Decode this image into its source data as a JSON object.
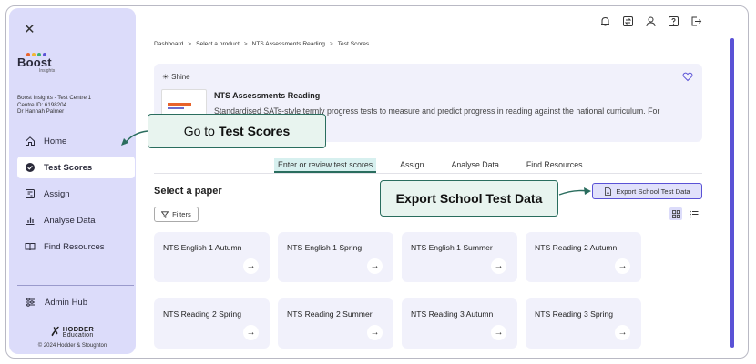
{
  "sidebar": {
    "close_glyph": "✕",
    "logo_word": "Boost",
    "logo_sub": "Insights",
    "centre_line1": "Boost Insights - Test Centre 1",
    "centre_line2": "Centre ID: 6198204",
    "centre_line3": "Dr Hannah Palmer",
    "items": [
      {
        "label": "Home",
        "icon": "home-icon"
      },
      {
        "label": "Test Scores",
        "icon": "check-circle-icon",
        "active": true
      },
      {
        "label": "Assign",
        "icon": "assign-icon"
      },
      {
        "label": "Analyse Data",
        "icon": "bar-chart-icon"
      },
      {
        "label": "Find Resources",
        "icon": "book-icon"
      }
    ],
    "admin_hub": "Admin Hub",
    "publisher_word": "HODDER",
    "publisher_sub": "Education",
    "copyright": "© 2024 Hodder & Stoughton"
  },
  "header": {
    "icons": [
      "bell-icon",
      "switch-icon",
      "user-icon",
      "help-icon",
      "logout-icon"
    ]
  },
  "breadcrumb": {
    "items": [
      "Dashboard",
      "Select a product",
      "NTS Assessments Reading",
      "Test Scores"
    ],
    "separator": ">"
  },
  "product": {
    "brand": "Shine",
    "title": "NTS Assessments Reading",
    "description": "Standardised SATs-style termly progress tests to measure and predict progress in reading against the national curriculum. For"
  },
  "callouts": {
    "first_prefix": "Go to",
    "first_bold": "Test Scores",
    "second": "Export School Test Data"
  },
  "tabs": [
    {
      "label": "Enter or review test scores",
      "active": true
    },
    {
      "label": "Assign"
    },
    {
      "label": "Analyse Data"
    },
    {
      "label": "Find Resources"
    }
  ],
  "main": {
    "select_paper": "Select a paper",
    "export_label": "Export School Test Data",
    "filters_label": "Filters"
  },
  "papers": [
    "NTS English 1 Autumn",
    "NTS English 1 Spring",
    "NTS English 1 Summer",
    "NTS Reading 2 Autumn",
    "NTS Reading 2 Spring",
    "NTS Reading 2 Summer",
    "NTS Reading 3 Autumn",
    "NTS Reading 3 Spring"
  ],
  "colors": {
    "sidebar_bg": "#dcdcfa",
    "accent": "#5a52d6",
    "callout_border": "#2a6d5e",
    "callout_bg": "#e8f4ef",
    "card_bg": "#f1f1fb"
  }
}
